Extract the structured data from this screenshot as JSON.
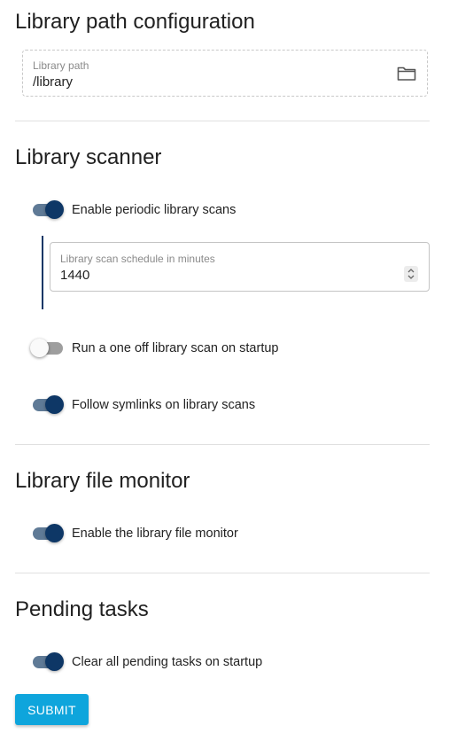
{
  "sections": {
    "path": {
      "title": "Library path configuration"
    },
    "scanner": {
      "title": "Library scanner"
    },
    "monitor": {
      "title": "Library file monitor"
    },
    "pending": {
      "title": "Pending tasks"
    }
  },
  "library_path": {
    "label": "Library path",
    "value": "/library",
    "icon": "folder-icon"
  },
  "scanner": {
    "periodic": {
      "label": "Enable periodic library scans",
      "enabled": true
    },
    "schedule": {
      "label": "Library scan schedule in minutes",
      "value": "1440"
    },
    "startup_scan": {
      "label": "Run a one off library scan on startup",
      "enabled": false
    },
    "symlinks": {
      "label": "Follow symlinks on library scans",
      "enabled": true
    }
  },
  "monitor": {
    "enable": {
      "label": "Enable the library file monitor",
      "enabled": true
    }
  },
  "pending": {
    "clear": {
      "label": "Clear all pending tasks on startup",
      "enabled": true
    }
  },
  "submit_label": "SUBMIT",
  "colors": {
    "accent": "#0e3766",
    "track_on": "#5f7a96",
    "submit": "#0ea5dc"
  }
}
